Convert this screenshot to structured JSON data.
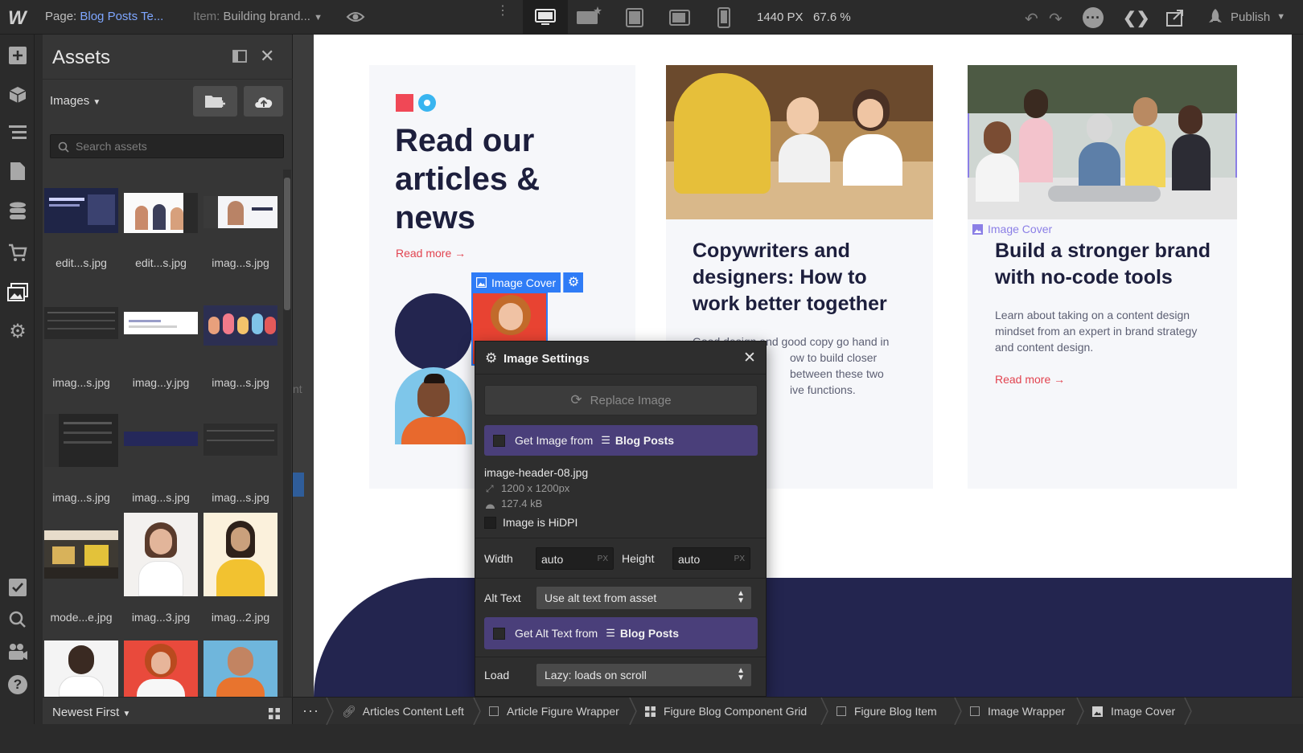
{
  "topbar": {
    "logo": "W",
    "page_label": "Page:",
    "page_name": "Blog Posts Te...",
    "item_label": "Item:",
    "item_name": "Building brand...",
    "width_px": "1440 PX",
    "zoom": "67.6 %",
    "publish": "Publish"
  },
  "assets": {
    "title": "Assets",
    "filter": "Images",
    "search_placeholder": "Search assets",
    "sort": "Newest First",
    "items": [
      {
        "label": "edit...s.jpg"
      },
      {
        "label": "edit...s.jpg"
      },
      {
        "label": "imag...s.jpg"
      },
      {
        "label": "imag...s.jpg"
      },
      {
        "label": "imag...y.jpg"
      },
      {
        "label": "imag...s.jpg"
      },
      {
        "label": "imag...s.jpg"
      },
      {
        "label": "imag...s.jpg"
      },
      {
        "label": "imag...s.jpg"
      },
      {
        "label": "mode...e.jpg"
      },
      {
        "label": "imag...3.jpg"
      },
      {
        "label": "imag...2.jpg"
      }
    ]
  },
  "canvas": {
    "hero_title_1": "Read our",
    "hero_title_2": "articles &",
    "hero_title_3": "news",
    "read_more": "Read more",
    "card2_title_1": "Copywriters and",
    "card2_title_2": "designers: How to",
    "card2_title_3": "work better together",
    "card2_body_1": "Good design and good copy go hand in",
    "card2_body_2": "ow to build closer",
    "card2_body_3": "between these two",
    "card2_body_4": "ive functions.",
    "card3_title_1": "Build a stronger brand",
    "card3_title_2": "with no-code tools",
    "card3_body_1": "Learn about taking on a content design",
    "card3_body_2": "mindset from an expert in brand strategy",
    "card3_body_3": "and content design.",
    "card3_read_more": "Read more",
    "image_cover_tag": "Image Cover",
    "image_cover_tag_2": "Image Cover",
    "strip_text": "nt"
  },
  "image_settings": {
    "title": "Image Settings",
    "replace": "Replace Image",
    "get_image_from": "Get Image from",
    "collection": "Blog Posts",
    "filename": "image-header-08.jpg",
    "dimensions": "1200 x 1200px",
    "filesize": "127.4 kB",
    "hidpi": "Image is HiDPI",
    "width_label": "Width",
    "width_value": "auto",
    "height_label": "Height",
    "height_value": "auto",
    "unit": "PX",
    "alt_label": "Alt Text",
    "alt_value": "Use alt text from asset",
    "get_alt_from": "Get Alt Text from",
    "alt_collection": "Blog Posts",
    "load_label": "Load",
    "load_value": "Lazy: loads on scroll"
  },
  "breadcrumbs": [
    {
      "label": "Articles Content Left"
    },
    {
      "label": "Article Figure Wrapper"
    },
    {
      "label": "Figure Blog Component Grid"
    },
    {
      "label": "Figure Blog Item"
    },
    {
      "label": "Image Wrapper"
    },
    {
      "label": "Image Cover"
    }
  ],
  "colors": {
    "accent": "#6b5bd6",
    "selection": "#2f7cf6",
    "navy": "#23254f",
    "red": "#e2434f"
  }
}
